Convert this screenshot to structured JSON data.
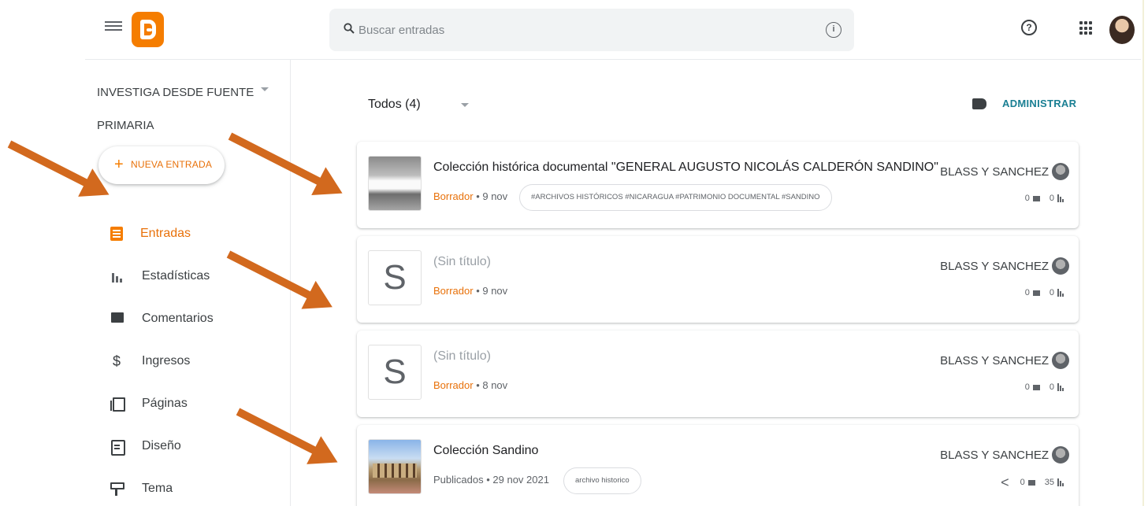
{
  "header": {
    "search_placeholder": "Buscar entradas",
    "help_glyph": "?",
    "info_glyph": "i"
  },
  "sidebar": {
    "blog_name": "INVESTIGA DESDE FUENTE PRIMARIA",
    "new_post": {
      "plus": "+",
      "label": "NUEVA ENTRADA"
    },
    "items": [
      {
        "label": "Entradas",
        "icon": "posts-icon",
        "active": true
      },
      {
        "label": "Estadísticas",
        "icon": "stats-icon"
      },
      {
        "label": "Comentarios",
        "icon": "comments-icon"
      },
      {
        "label": "Ingresos",
        "icon": "money-icon",
        "glyph": "$"
      },
      {
        "label": "Páginas",
        "icon": "pages-icon"
      },
      {
        "label": "Diseño",
        "icon": "layout-icon"
      },
      {
        "label": "Tema",
        "icon": "theme-icon"
      }
    ]
  },
  "main": {
    "filter_label": "Todos (4)",
    "manage_label": "ADMINISTRAR",
    "posts": [
      {
        "thumb_letter": "",
        "title": "Colección histórica documental \"GENERAL AUGUSTO NICOLÁS CALDERÓN SANDINO\"",
        "status": "Borrador",
        "sep": " • ",
        "date": "9 nov",
        "labels": "#ARCHIVOS HISTÓRICOS #NICARAGUA #PATRIMONIO DOCUMENTAL #SANDINO",
        "author": "BLASS Y SANCHEZ",
        "comments": "0",
        "views": "0"
      },
      {
        "thumb_letter": "S",
        "title": "(Sin título)",
        "status": "Borrador",
        "sep": " • ",
        "date": "9 nov",
        "author": "BLASS Y SANCHEZ",
        "comments": "0",
        "views": "0"
      },
      {
        "thumb_letter": "S",
        "title": "(Sin título)",
        "status": "Borrador",
        "sep": " • ",
        "date": "8 nov",
        "author": "BLASS Y SANCHEZ",
        "comments": "0",
        "views": "0"
      },
      {
        "thumb_letter": "",
        "title": "Colección Sandino",
        "status": "Publicados",
        "sep": " • ",
        "date": "29 nov 2021",
        "labels": "archivo historico",
        "author": "BLASS Y SANCHEZ",
        "comments": "0",
        "views": "35"
      }
    ]
  },
  "colors": {
    "brand": "#f57d00",
    "accent_text": "#e8710a",
    "manage_link": "#1a7f93",
    "annotation_arrow": "#d2691e"
  }
}
